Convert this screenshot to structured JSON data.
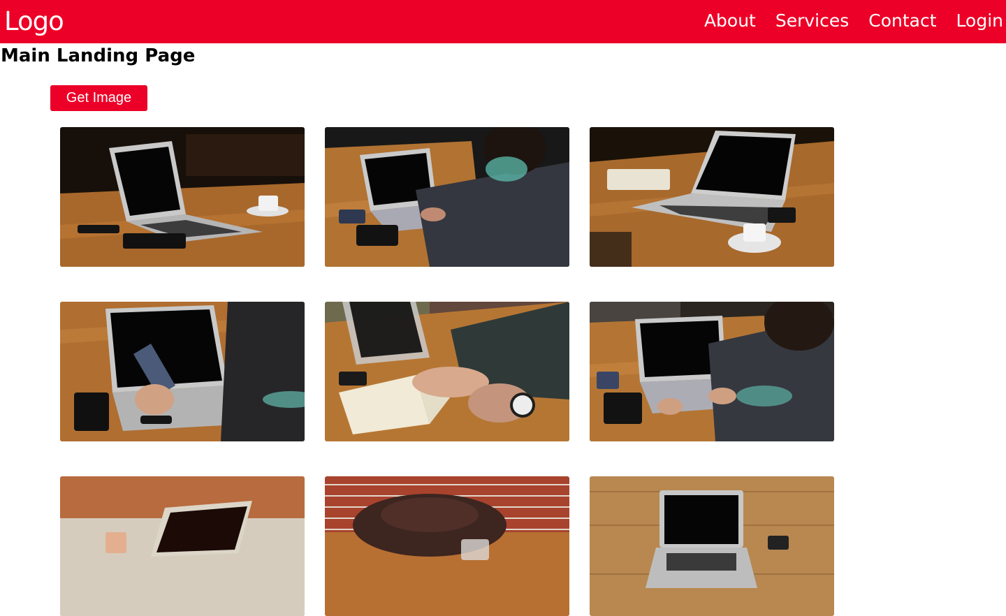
{
  "header": {
    "logo": "Logo",
    "nav": [
      "About",
      "Services",
      "Contact",
      "Login"
    ]
  },
  "main": {
    "title": "Main Landing Page",
    "get_image_label": "Get Image"
  },
  "gallery": {
    "images": [
      "laptop-on-table-photo",
      "person-typing-laptop-photo",
      "laptop-with-notebook-photo",
      "hand-holding-phone-photo",
      "writing-in-notebook-photo",
      "person-typing-laptop-photo",
      "laptop-cafe-photo",
      "leather-bag-photo",
      "laptop-on-wood-table-photo"
    ]
  },
  "colors": {
    "brand": "#ec0027",
    "text": "#000000"
  }
}
